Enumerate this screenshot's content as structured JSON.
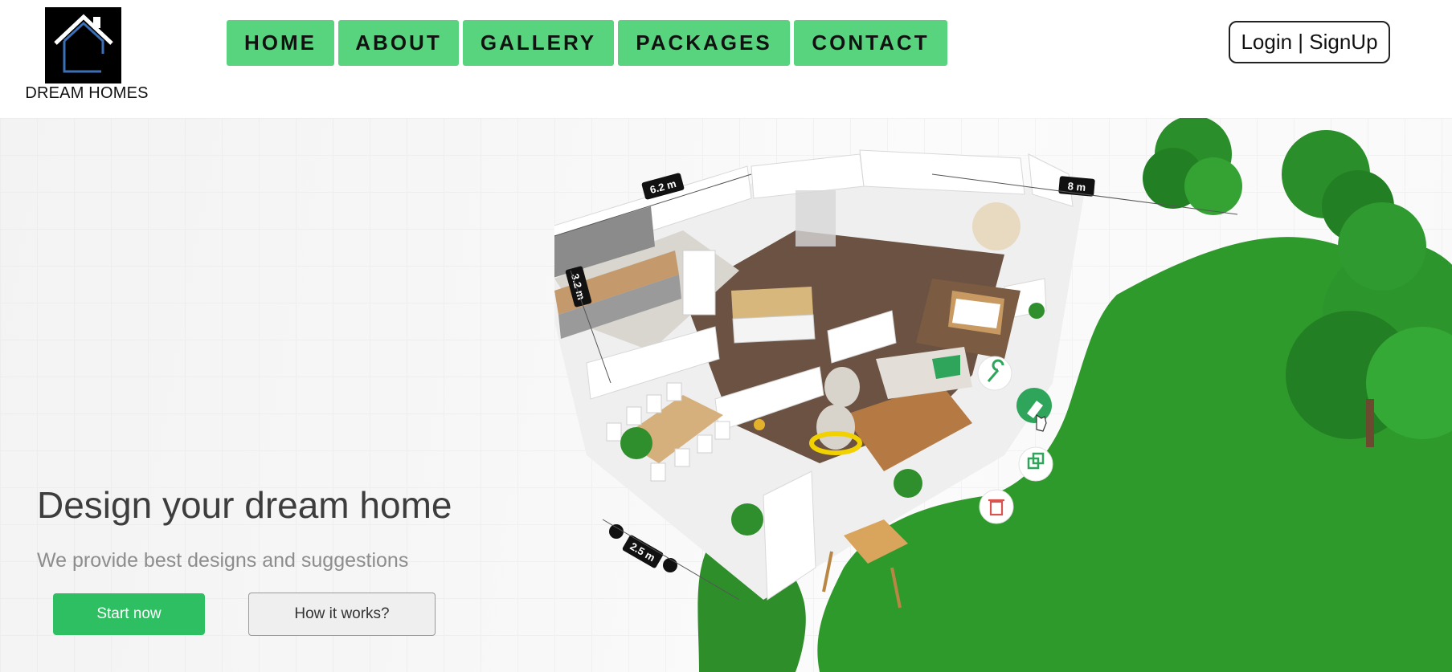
{
  "brand": {
    "name": "DREAM HOMES"
  },
  "nav": {
    "items": [
      {
        "label": "HOME"
      },
      {
        "label": "ABOUT"
      },
      {
        "label": "GALLERY"
      },
      {
        "label": "PACKAGES"
      },
      {
        "label": "CONTACT"
      }
    ],
    "accent": "#58d47e"
  },
  "auth": {
    "label": "Login | SignUp"
  },
  "hero": {
    "title": "Design your dream home",
    "subtitle": "We provide best designs and suggestions",
    "primary_button": "Start now",
    "secondary_button": "How it works?",
    "primary_color": "#2fbf63"
  },
  "floorplan": {
    "dimensions": {
      "kitchen_width": "6.2 m",
      "house_length": "8 m",
      "kitchen_depth": "3.2 m",
      "front_width": "2.5 m"
    },
    "tools": [
      "wrench-icon",
      "paint-brush-icon",
      "copy-icon",
      "trash-icon"
    ]
  }
}
